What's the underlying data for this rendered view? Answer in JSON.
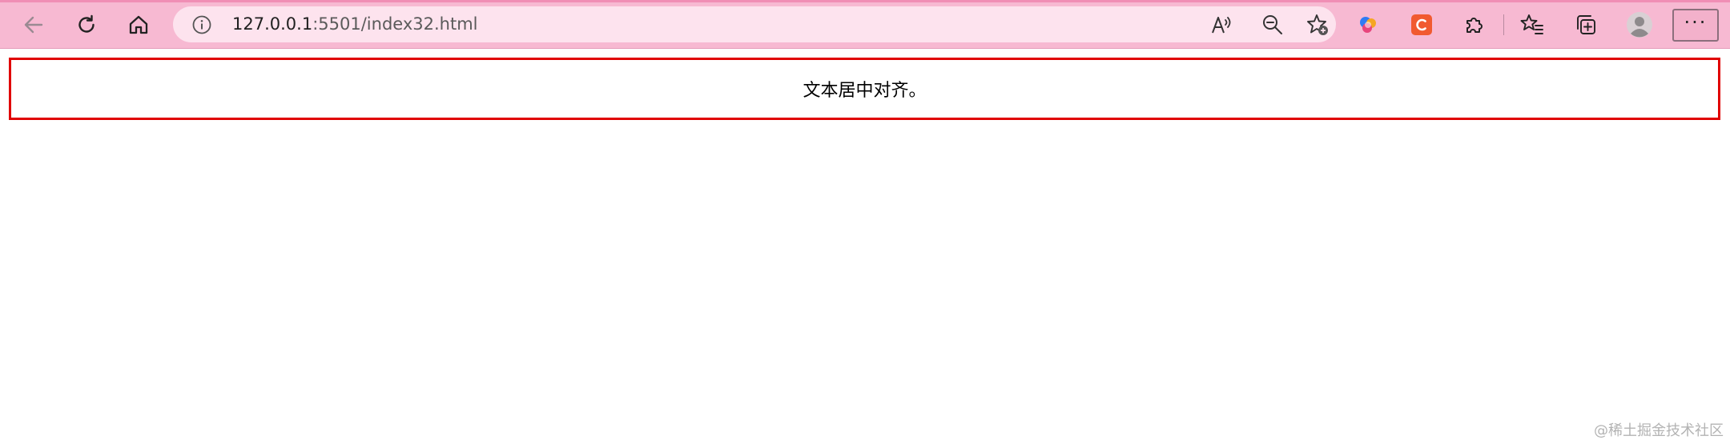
{
  "browser": {
    "address_bar": {
      "url_host": "127.0.0.1",
      "url_rest": ":5501/index32.html"
    },
    "icons": {
      "back": "arrow-left-icon",
      "refresh": "refresh-icon",
      "home": "home-icon",
      "site_info": "info-circle-icon",
      "read_aloud": "read-aloud-icon",
      "zoom_out": "zoom-out-icon",
      "add_favorite": "star-add-icon",
      "extension_1": "copilot-icon",
      "extension_2": "csdn-c-icon",
      "extensions": "puzzle-icon",
      "favorites": "favorites-icon",
      "collections": "collections-icon",
      "profile": "profile-avatar-icon",
      "more": "more-icon"
    },
    "more_label": "···"
  },
  "page": {
    "demo_text": "文本居中对齐。"
  },
  "watermark": "@稀土掘金技术社区",
  "colors": {
    "toolbar_bg": "#f7b9d2",
    "address_bg": "#fde3ee",
    "box_border": "#e00000",
    "extension_c_bg": "#f15a30"
  }
}
